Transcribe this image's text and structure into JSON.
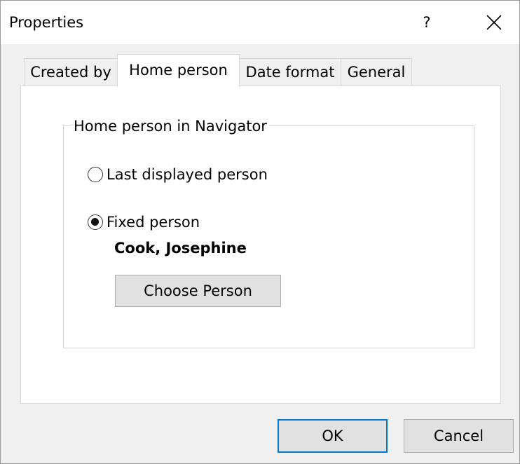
{
  "window": {
    "title": "Properties",
    "help_label": "?"
  },
  "tabs": [
    {
      "label": "Created by",
      "active": false
    },
    {
      "label": "Home person",
      "active": true
    },
    {
      "label": "Date format",
      "active": false
    },
    {
      "label": "General",
      "active": false
    }
  ],
  "group": {
    "legend": "Home person in Navigator",
    "options": [
      {
        "label": "Last displayed person",
        "checked": false
      },
      {
        "label": "Fixed person",
        "checked": true
      }
    ],
    "selected_person": "Cook, Josephine",
    "choose_button_label": "Choose Person"
  },
  "buttons": {
    "ok_label": "OK",
    "cancel_label": "Cancel"
  },
  "colors": {
    "accent": "#0078d7",
    "button_face": "#e1e1e1",
    "dialog_bg": "#f0f0f0"
  }
}
